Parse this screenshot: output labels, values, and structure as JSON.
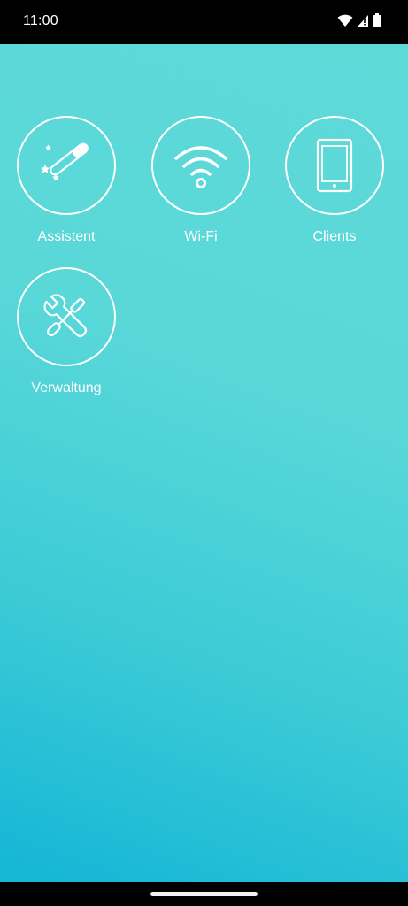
{
  "status_bar": {
    "time": "11:00",
    "icons": [
      "wifi-icon",
      "cellular-signal-icon",
      "battery-icon"
    ]
  },
  "tiles": [
    {
      "label": "Assistent",
      "icon": "magic-wand-icon"
    },
    {
      "label": "Wi-Fi",
      "icon": "wifi-icon"
    },
    {
      "label": "Clients",
      "icon": "tablet-icon"
    },
    {
      "label": "Verwaltung",
      "icon": "tools-icon"
    }
  ],
  "colors": {
    "background_top": "#5dd9d8",
    "background_bottom": "#14b5d6",
    "foreground": "#ffffff",
    "status_bar": "#000000"
  }
}
